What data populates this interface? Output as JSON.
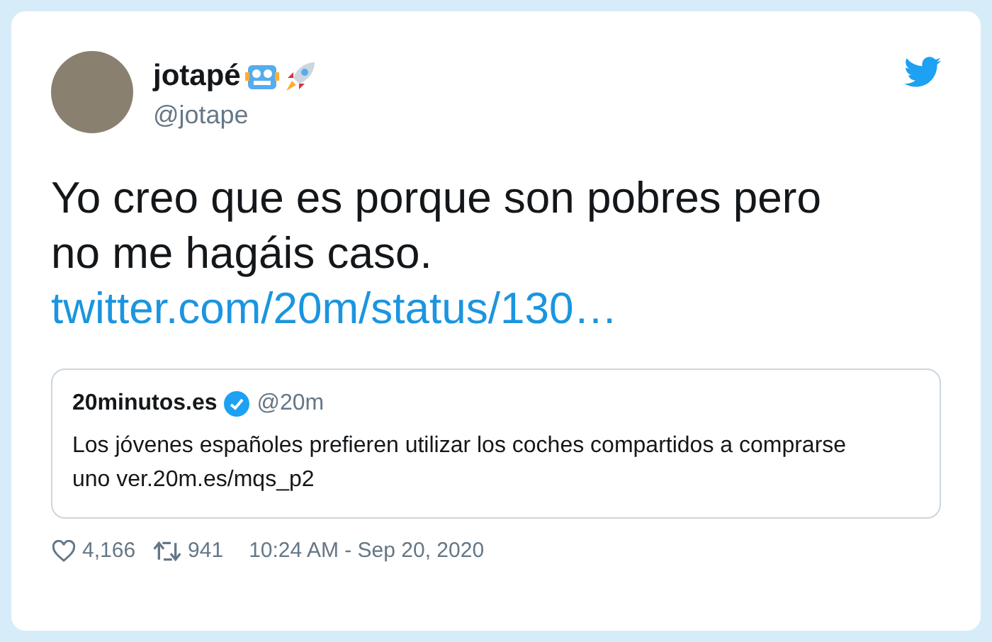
{
  "author": {
    "name": "jotapé",
    "handle": "@jotape"
  },
  "tweet": {
    "text_lines": [
      "Yo creo que es porque son pobres pero",
      "no me hagáis caso."
    ],
    "link": "twitter.com/20m/status/130…"
  },
  "quoted": {
    "name": "20minutos.es",
    "verified": true,
    "handle": "@20m",
    "text": "Los jóvenes españoles prefieren utilizar los coches compartidos a comprarse uno ver.20m.es/mqs_p2"
  },
  "footer": {
    "likes": "4,166",
    "retweets": "941",
    "timestamp": "10:24 AM - Sep 20, 2020"
  }
}
